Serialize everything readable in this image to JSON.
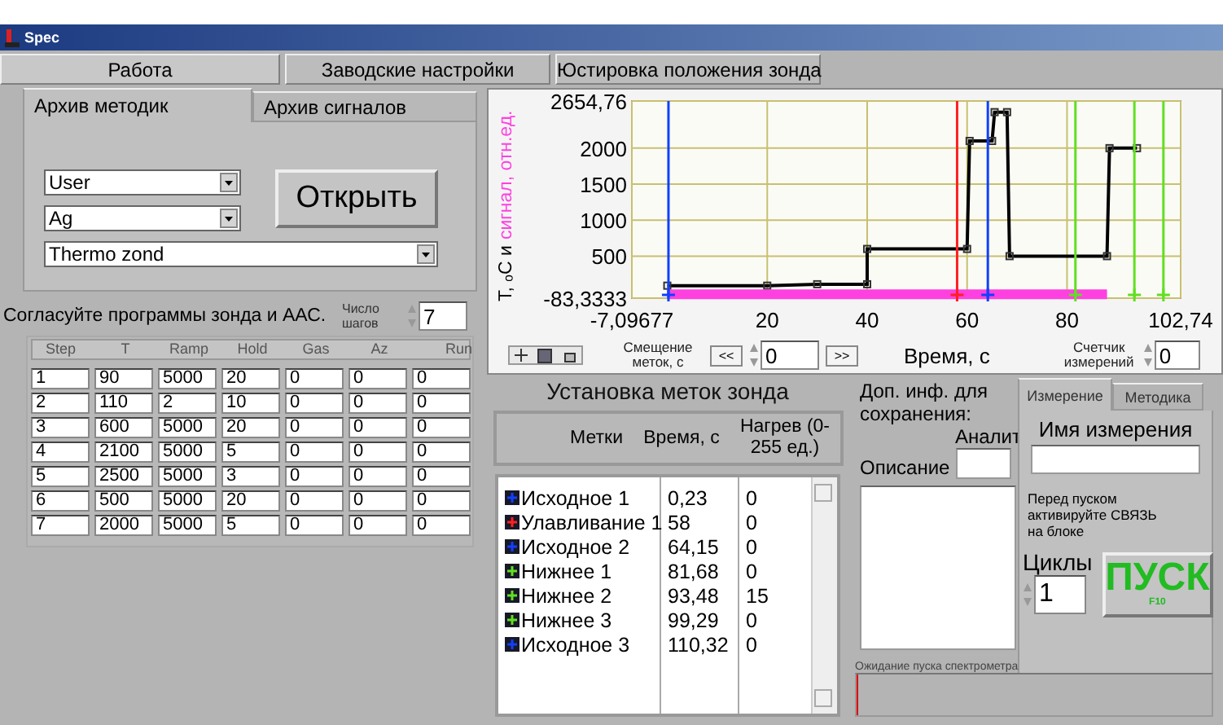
{
  "window": {
    "title": "Spec"
  },
  "main_tabs": [
    {
      "label": "Работа",
      "selected": true
    },
    {
      "label": "Заводские настройки",
      "selected": false
    },
    {
      "label": "Юстировка положения зонда",
      "selected": false
    }
  ],
  "archive_tabs": [
    {
      "label": "Архив методик",
      "selected": true
    },
    {
      "label": "Архив сигналов",
      "selected": false
    }
  ],
  "dropdowns": [
    {
      "value": "User",
      "wide": false
    },
    {
      "value": "Ag",
      "wide": false
    },
    {
      "value": "Thermo zond",
      "wide": true
    }
  ],
  "open_button": "Открыть",
  "program_note": "Согласуйте программы зонда и ААС.",
  "steps_count": {
    "label": "Число шагов",
    "value": "7"
  },
  "program_table": {
    "columns": [
      "Step",
      "T",
      "Ramp",
      "Hold",
      "Gas",
      "Az",
      "Run"
    ],
    "rows": [
      [
        "1",
        "90",
        "5000",
        "20",
        "0",
        "0",
        "0"
      ],
      [
        "2",
        "110",
        "2",
        "10",
        "0",
        "0",
        "0"
      ],
      [
        "3",
        "600",
        "5000",
        "20",
        "0",
        "0",
        "0"
      ],
      [
        "4",
        "2100",
        "5000",
        "5",
        "0",
        "0",
        "0"
      ],
      [
        "5",
        "2500",
        "5000",
        "3",
        "0",
        "0",
        "0"
      ],
      [
        "6",
        "500",
        "5000",
        "20",
        "0",
        "0",
        "0"
      ],
      [
        "7",
        "2000",
        "5000",
        "5",
        "0",
        "0",
        "0"
      ]
    ]
  },
  "chart": {
    "ylabel_parts": [
      {
        "text": "Т, ₒС и ",
        "color": "#000000"
      },
      {
        "text": "сигнал, отн.ед.",
        "color": "#ff40e0"
      }
    ],
    "chart_data": {
      "type": "line",
      "xlabel": "Время, с",
      "x": [
        0,
        20,
        30,
        40,
        40,
        60,
        60.5,
        65,
        65.5,
        68,
        68.5,
        88,
        88.5,
        94
      ],
      "series": [
        {
          "color": "#000000",
          "marker": "square",
          "values": [
            90,
            90,
            110,
            110,
            600,
            600,
            2100,
            2100,
            2500,
            2500,
            500,
            500,
            2000,
            2000
          ]
        },
        {
          "color": "#ff40e0",
          "values": [
            -30,
            -30,
            -30,
            -30,
            -30,
            -30,
            -30,
            -30,
            -30,
            -30,
            -30,
            -30,
            null,
            null
          ]
        }
      ],
      "xlim": [
        -7.09677,
        102.74
      ],
      "ylim": [
        -83.3333,
        2654.76
      ],
      "xticks": [
        {
          "value": -7.09677,
          "label": "-7,09677"
        },
        20,
        40,
        60,
        80,
        {
          "value": 102.74,
          "label": "102,74"
        }
      ],
      "yticks": [
        {
          "value": -83.3333,
          "label": "-83,3333"
        },
        500,
        1000,
        1500,
        2000,
        {
          "value": 2654.76,
          "label": "2654,76"
        }
      ],
      "grid": true,
      "ref_lines": [
        {
          "axis": "x",
          "value": 0.23,
          "color": "#1040ff"
        },
        {
          "axis": "x",
          "value": 58,
          "color": "#ff2020"
        },
        {
          "axis": "x",
          "value": 64.15,
          "color": "#1040ff"
        },
        {
          "axis": "x",
          "value": 81.68,
          "color": "#60e020"
        },
        {
          "axis": "x",
          "value": 93.48,
          "color": "#60e020"
        },
        {
          "axis": "x",
          "value": 99.29,
          "color": "#60e020"
        }
      ]
    },
    "marker_shift": {
      "label": "Смещение меток, с",
      "prev": "<<",
      "value": "0",
      "next": ">>"
    },
    "counter": {
      "label": "Счетчик измерений",
      "value": "0"
    }
  },
  "marks": {
    "title": "Установка меток зонда",
    "columns": [
      "Метки",
      "Время, с",
      "Нагрев (0-255 ед.)"
    ],
    "items": [
      {
        "name": "Исходное 1",
        "time": "0,23",
        "heat": "0",
        "color": "#1040ff"
      },
      {
        "name": "Улавливание 1",
        "time": "58",
        "heat": "0",
        "color": "#ff2020"
      },
      {
        "name": "Исходное 2",
        "time": "64,15",
        "heat": "0",
        "color": "#1040ff"
      },
      {
        "name": "Нижнее 1",
        "time": "81,68",
        "heat": "0",
        "color": "#60e020"
      },
      {
        "name": "Нижнее 2",
        "time": "93,48",
        "heat": "15",
        "color": "#60e020"
      },
      {
        "name": "Нижнее 3",
        "time": "99,29",
        "heat": "0",
        "color": "#60e020"
      },
      {
        "name": "Исходное 3",
        "time": "110,32",
        "heat": "0",
        "color": "#1040ff"
      }
    ]
  },
  "save_info": {
    "title": "Доп. инф. для сохранения:",
    "analyte_label": "Аналит",
    "description_label": "Описание"
  },
  "run_tabs": [
    {
      "label": "Измерение",
      "selected": true
    },
    {
      "label": "Методика",
      "selected": false
    }
  ],
  "measurement_name_label": "Имя измерения",
  "run_note": "Перед пуском активируйте СВЯЗЬ на блоке",
  "cycles": {
    "label": "Циклы",
    "value": "1"
  },
  "start_button": {
    "label": "ПУСК",
    "hotkey": "F10"
  },
  "status": {
    "label": "Ожидание пуска спектрометра",
    "level": 0.006
  }
}
